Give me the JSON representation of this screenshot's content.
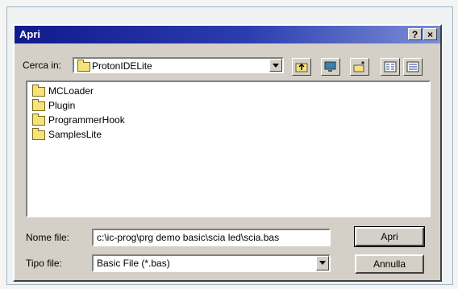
{
  "dialog": {
    "title": "Apri",
    "help_label": "?",
    "close_label": "×"
  },
  "look_in": {
    "label": "Cerca in:",
    "value": "ProtonIDELite"
  },
  "files": [
    {
      "name": "MCLoader"
    },
    {
      "name": "Plugin"
    },
    {
      "name": "ProgrammerHook"
    },
    {
      "name": "SamplesLite"
    }
  ],
  "filename": {
    "label": "Nome file:",
    "value": "c:\\ic-prog\\prg demo basic\\scia led\\scia.bas"
  },
  "filetype": {
    "label": "Tipo file:",
    "value": "Basic File (*.bas)"
  },
  "buttons": {
    "open": "Apri",
    "cancel": "Annulla"
  }
}
